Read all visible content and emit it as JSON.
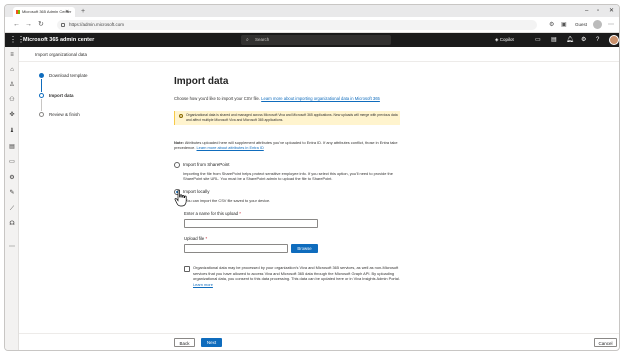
{
  "browser": {
    "tab_title": "Microsoft 365 Admin Center",
    "url": "https://admin.microsoft.com",
    "profile_label": "Guest"
  },
  "header": {
    "app_title": "Microsoft 365 admin center",
    "search_placeholder": "Search",
    "copilot_label": "Copilot"
  },
  "page": {
    "breadcrumb": "Import organizational data"
  },
  "steps": [
    {
      "label": "Download template",
      "state": "done"
    },
    {
      "label": "Import data",
      "state": "current"
    },
    {
      "label": "Review & finish",
      "state": "todo"
    }
  ],
  "main": {
    "title": "Import data",
    "intro": "Choose how you'd like to import your CSV file.",
    "intro_link": "Learn more about importing organizational data in Microsoft 365",
    "banner_text": "Organizational data is shared and managed across Microsoft Viva and Microsoft 365 applications. New uploads will merge with previous data and affect multiple Microsoft Viva and Microsoft 365 applications.",
    "note_bold": "Note:",
    "note_text": "Attributes uploaded here will supplement attributes you've uploaded to Entra ID. If any attributes conflict, those in Entra take precedence.",
    "note_link": "Learn more about attributes in Entra ID",
    "option_sharepoint": "Import from SharePoint",
    "option_sharepoint_desc": "Importing the file from SharePoint helps protect sensitive employee info. If you select this option, you'll need to provide the SharePoint site URL. You must be a SharePoint admin to upload the file to SharePoint.",
    "option_local": "Import locally",
    "option_local_desc": "You can import the CSV file saved to your device.",
    "upload_name_label": "Enter a name for this upload",
    "upload_file_label": "Upload file",
    "required_mark": "*",
    "browse_label": "Browse",
    "consent_text": "Organizational data may be processed by your organization's Viva and Microsoft 365 services, as well as non-Microsoft services that you have allowed to access Viva and Microsoft 365 data through the Microsoft Graph API. By uploading organizational data, you consent to this data processing. This data can be updated here or in Viva Insights Admin Portal.",
    "consent_link": "Learn more"
  },
  "footer": {
    "back_label": "Back",
    "next_label": "Next",
    "cancel_label": "Cancel"
  },
  "colors": {
    "accent": "#0f6cbd",
    "header_bg": "#1b1b1b",
    "banner_bg": "#fff4ce"
  }
}
